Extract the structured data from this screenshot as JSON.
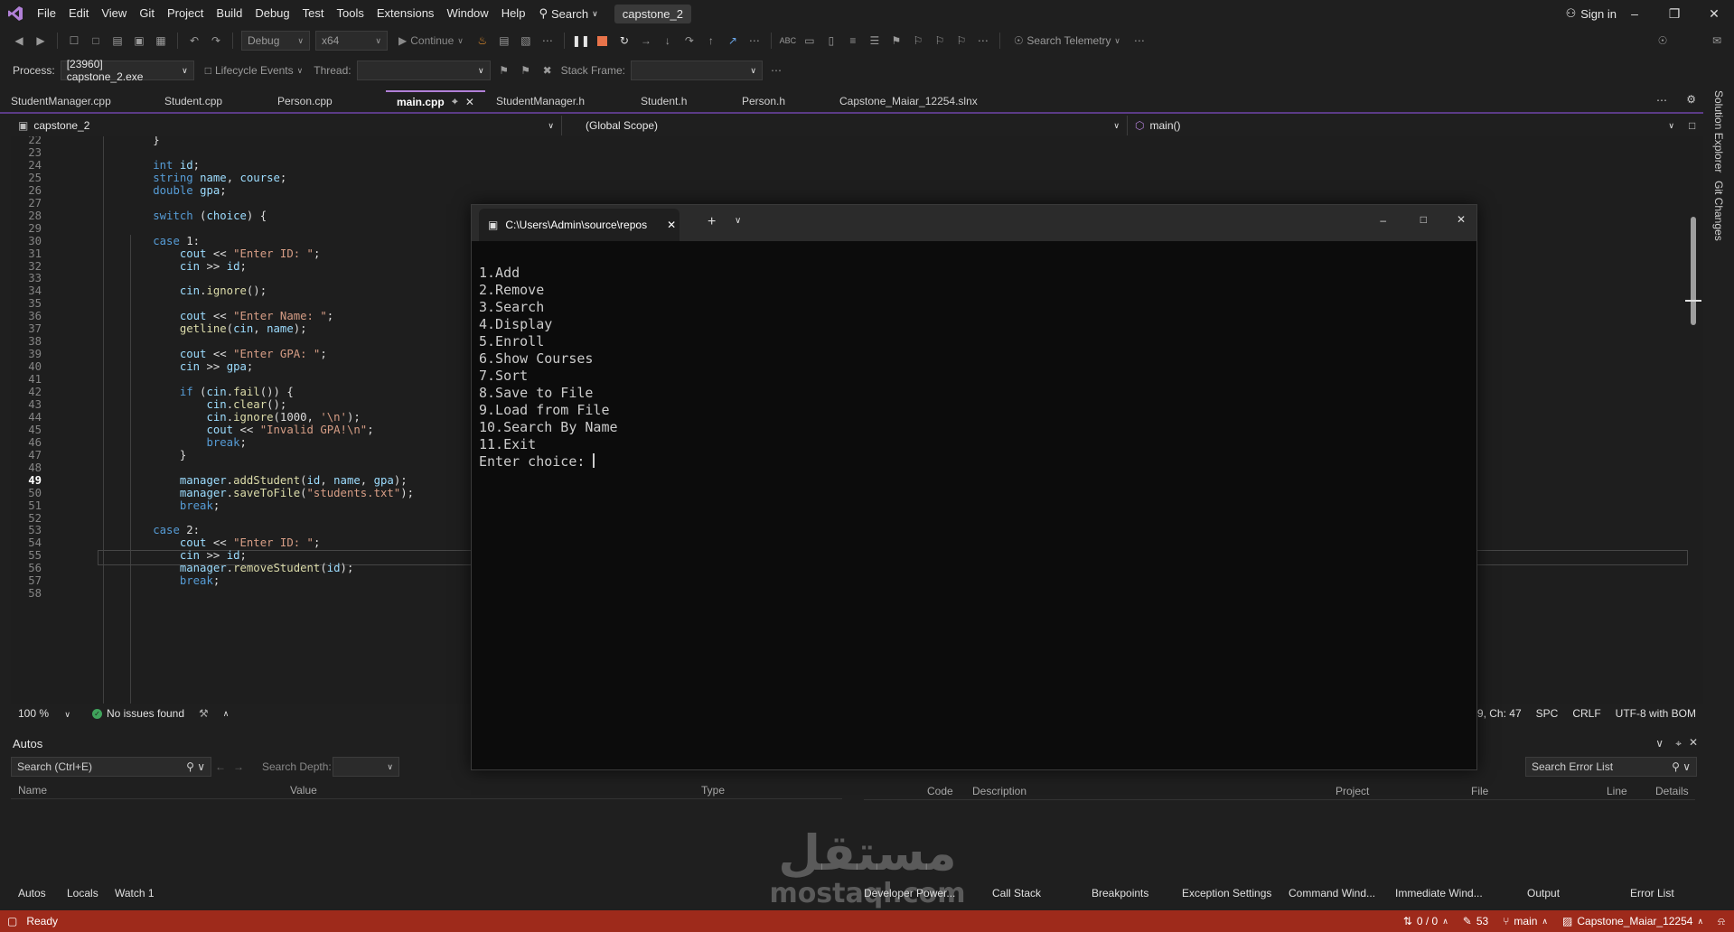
{
  "menubar": {
    "items": [
      "File",
      "Edit",
      "View",
      "Git",
      "Project",
      "Build",
      "Debug",
      "Test",
      "Tools",
      "Extensions",
      "Window",
      "Help"
    ],
    "search_label": "Search",
    "solution_name": "capstone_2",
    "signin_label": "Sign in"
  },
  "toolbar": {
    "config": "Debug",
    "platform": "x64",
    "continue_label": "Continue",
    "search_telemetry": "Search Telemetry"
  },
  "debugbar": {
    "process_label": "Process:",
    "process_value": "[23960] capstone_2.exe",
    "lifecycle_label": "Lifecycle Events",
    "thread_label": "Thread:",
    "stackframe_label": "Stack Frame:"
  },
  "tabs": [
    "StudentManager.cpp",
    "Student.cpp",
    "Person.cpp",
    "main.cpp",
    "StudentManager.h",
    "Student.h",
    "Person.h",
    "Capstone_Maiar_12254.slnx"
  ],
  "navbar": {
    "project": "capstone_2",
    "scope": "(Global Scope)",
    "member": "main()"
  },
  "editor": {
    "lines": [
      {
        "n": "22",
        "t": "        }"
      },
      {
        "n": "23",
        "t": ""
      },
      {
        "n": "24",
        "t": "        int id;"
      },
      {
        "n": "25",
        "t": "        string name, course;"
      },
      {
        "n": "26",
        "t": "        double gpa;"
      },
      {
        "n": "27",
        "t": ""
      },
      {
        "n": "28",
        "t": "        switch (choice) {"
      },
      {
        "n": "29",
        "t": ""
      },
      {
        "n": "30",
        "t": "        case 1:"
      },
      {
        "n": "31",
        "t": "            cout << \"Enter ID: \";"
      },
      {
        "n": "32",
        "t": "            cin >> id;"
      },
      {
        "n": "33",
        "t": ""
      },
      {
        "n": "34",
        "t": "            cin.ignore();"
      },
      {
        "n": "35",
        "t": ""
      },
      {
        "n": "36",
        "t": "            cout << \"Enter Name: \";"
      },
      {
        "n": "37",
        "t": "            getline(cin, name);"
      },
      {
        "n": "38",
        "t": ""
      },
      {
        "n": "39",
        "t": "            cout << \"Enter GPA: \";"
      },
      {
        "n": "40",
        "t": "            cin >> gpa;"
      },
      {
        "n": "41",
        "t": ""
      },
      {
        "n": "42",
        "t": "            if (cin.fail()) {"
      },
      {
        "n": "43",
        "t": "                cin.clear();"
      },
      {
        "n": "44",
        "t": "                cin.ignore(1000, '\\n');"
      },
      {
        "n": "45",
        "t": "                cout << \"Invalid GPA!\\n\";"
      },
      {
        "n": "46",
        "t": "                break;"
      },
      {
        "n": "47",
        "t": "            }"
      },
      {
        "n": "48",
        "t": ""
      },
      {
        "n": "49",
        "t": "            manager.addStudent(id, name, gpa);"
      },
      {
        "n": "50",
        "t": "            manager.saveToFile(\"students.txt\");"
      },
      {
        "n": "51",
        "t": "            break;"
      },
      {
        "n": "52",
        "t": ""
      },
      {
        "n": "53",
        "t": "        case 2:"
      },
      {
        "n": "54",
        "t": "            cout << \"Enter ID: \";"
      },
      {
        "n": "55",
        "t": "            cin >> id;"
      },
      {
        "n": "56",
        "t": "            manager.removeStudent(id);"
      },
      {
        "n": "57",
        "t": "            break;"
      },
      {
        "n": "58",
        "t": ""
      }
    ]
  },
  "editor_status": {
    "zoom": "100 %",
    "issues": "No issues found",
    "position": "Ln: 49, Ch: 47",
    "indent": "SPC",
    "eol": "CRLF",
    "encoding": "UTF-8 with BOM"
  },
  "console": {
    "title": "C:\\Users\\Admin\\source\\repos",
    "lines": [
      "1.Add",
      "2.Remove",
      "3.Search",
      "4.Display",
      "5.Enroll",
      "6.Show Courses",
      "7.Sort",
      "8.Save to File",
      "9.Load from File",
      "10.Search By Name",
      "11.Exit"
    ],
    "prompt": "Enter choice: "
  },
  "sidebar": {
    "solution_explorer": "Solution Explorer",
    "git_changes": "Git Changes"
  },
  "autos": {
    "title": "Autos",
    "search_placeholder": "Search (Ctrl+E)",
    "search_depth_label": "Search Depth:",
    "columns": [
      "Name",
      "Value",
      "Type"
    ],
    "tabs": [
      "Autos",
      "Locals",
      "Watch 1"
    ]
  },
  "errors": {
    "search_placeholder": "Search Error List",
    "columns": [
      "Code",
      "Description",
      "Project",
      "File",
      "Line",
      "Details"
    ],
    "tabs": [
      "Developer Power...",
      "Call Stack",
      "Breakpoints",
      "Exception Settings",
      "Command Wind...",
      "Immediate Wind...",
      "Output",
      "Error List"
    ]
  },
  "statusbar": {
    "state": "Ready",
    "sync": "0 / 0",
    "edits": "53",
    "branch": "main",
    "repo": "Capstone_Maiar_12254"
  },
  "watermark": {
    "arabic": "مستقل",
    "latin": "mostaql.com"
  },
  "colors": {
    "accent": "#b180d7",
    "statusbar": "#9e2a1b",
    "console_bg": "#0c0c0c"
  }
}
